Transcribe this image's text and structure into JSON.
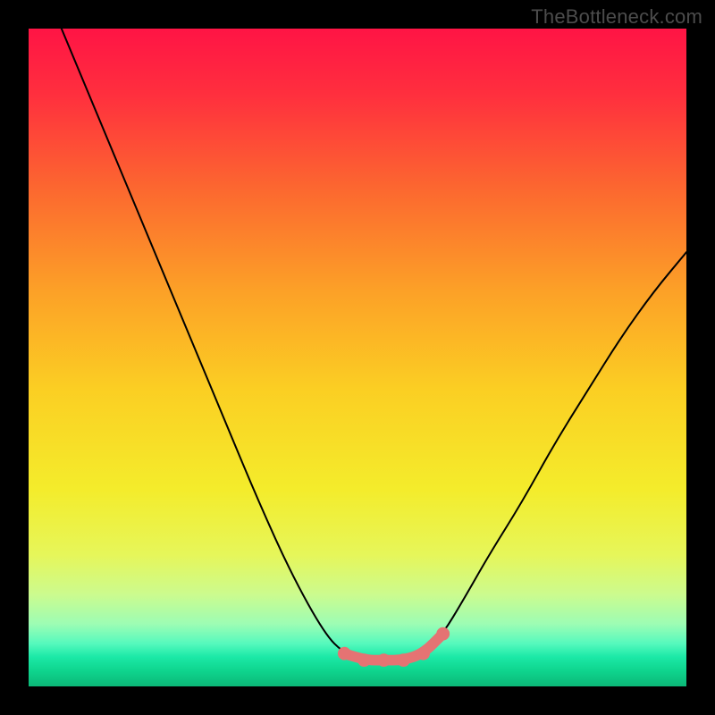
{
  "watermark": "TheBottleneck.com",
  "chart_data": {
    "type": "line",
    "title": "",
    "xlabel": "",
    "ylabel": "",
    "xlim": [
      0,
      100
    ],
    "ylim": [
      0,
      100
    ],
    "grid": false,
    "legend": false,
    "background_gradient_stops": [
      {
        "offset": 0.0,
        "color": "#ff1445"
      },
      {
        "offset": 0.1,
        "color": "#ff2f3e"
      },
      {
        "offset": 0.25,
        "color": "#fc6a2f"
      },
      {
        "offset": 0.4,
        "color": "#fca127"
      },
      {
        "offset": 0.55,
        "color": "#fbcf23"
      },
      {
        "offset": 0.7,
        "color": "#f4ec2b"
      },
      {
        "offset": 0.8,
        "color": "#e6f65a"
      },
      {
        "offset": 0.86,
        "color": "#ccfb8e"
      },
      {
        "offset": 0.905,
        "color": "#9dfdb4"
      },
      {
        "offset": 0.935,
        "color": "#55f9bd"
      },
      {
        "offset": 0.955,
        "color": "#1ce9a7"
      },
      {
        "offset": 0.975,
        "color": "#0fd68f"
      },
      {
        "offset": 1.0,
        "color": "#0bb877"
      }
    ],
    "curve": {
      "description": "V-shaped bottleneck curve. Units are % of plot width/height (0–100).",
      "x": [
        5,
        10,
        15,
        20,
        25,
        30,
        35,
        40,
        45,
        48,
        51,
        54,
        57,
        60,
        63,
        66,
        70,
        75,
        80,
        85,
        90,
        95,
        100
      ],
      "y": [
        100,
        88,
        76,
        64,
        52,
        40,
        28,
        17,
        8,
        5,
        4,
        4,
        4,
        5,
        8,
        13,
        20,
        28,
        37,
        45,
        53,
        60,
        66
      ]
    },
    "highlight": {
      "description": "Pink/coral flat segment at curve minimum, with dots.",
      "color": "#e57373",
      "x": [
        48,
        51,
        54,
        57,
        60,
        63
      ],
      "y": [
        5,
        4,
        4,
        4,
        5,
        8
      ],
      "dot_radius": 1.0,
      "stroke_width": 1.6
    }
  }
}
